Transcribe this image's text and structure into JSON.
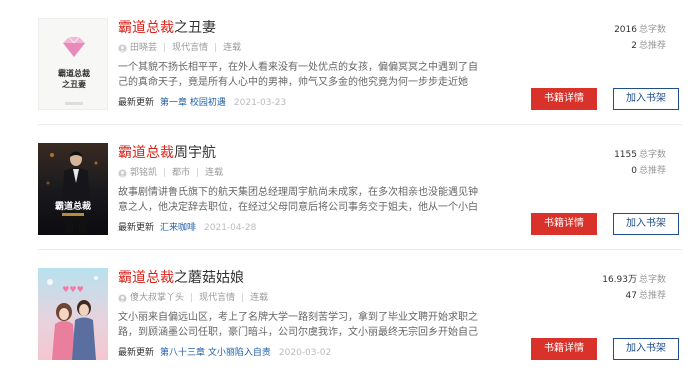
{
  "books": [
    {
      "title_highlight": "霸道总裁",
      "title_rest": "之丑妻",
      "author": "田晓芸",
      "genre": "现代言情",
      "status": "连载",
      "description": "一个其貌不扬长相平平，在外人看来没有一处优点的女孩，偏偏冥冥之中遇到了自己的真命天子，竟是所有人心中的男神，帅气又多金的他究竟为何一步步走近她呢？其中又",
      "latest_label": "最新更新",
      "latest_chapter": "第一章 校园初遇",
      "latest_date": "2021-03-23",
      "word_count": "2016",
      "word_count_unit": "总字数",
      "recommend_count": "2",
      "recommend_unit": "总推荐",
      "detail_label": "书籍详情",
      "shelf_label": "加入书架",
      "cover_title_line1": "霸道总裁",
      "cover_title_line2": "之丑妻",
      "cover_icon": "diamond-icon"
    },
    {
      "title_highlight": "霸道总裁",
      "title_rest": "周宇航",
      "author": "郭铭凯",
      "genre": "都市",
      "status": "连载",
      "description": "故事剧情讲鲁氏旗下的航天集团总经理周宇航尚未成家，在多次相亲也没能遇见钟意之人，他决定辞去职位，在经过父母同意后将公司事务交于姐夫，他从一个小白开始了他",
      "latest_label": "最新更新",
      "latest_chapter": "汇来咖啡",
      "latest_date": "2021-04-28",
      "word_count": "1155",
      "word_count_unit": "总字数",
      "recommend_count": "0",
      "recommend_unit": "总推荐",
      "detail_label": "书籍详情",
      "shelf_label": "加入书架",
      "cover_title_line1": "霸道总裁"
    },
    {
      "title_highlight": "霸道总裁",
      "title_rest": "之蘑菇姑娘",
      "author": "傻大叔掌丫头",
      "genre": "现代言情",
      "status": "连载",
      "description": "文小丽来自偏远山区，考上了名牌大学一路刻苦学习，拿到了毕业文聘开始求职之路，到顾涵墨公司任职，豪门暗斗，公司尔虞我诈，文小丽最终无宗回乡开始自己的传奇故",
      "latest_label": "最新更新",
      "latest_chapter": "第八十三章 文小丽陷入自责",
      "latest_date": "2020-03-02",
      "word_count": "16.93万",
      "word_count_unit": "总字数",
      "recommend_count": "47",
      "recommend_unit": "总推荐",
      "detail_label": "书籍详情",
      "shelf_label": "加入书架"
    }
  ],
  "colors": {
    "accent_red": "#d8322a",
    "link_blue": "#1f5fa8",
    "shelf_blue": "#1f4f8a"
  }
}
